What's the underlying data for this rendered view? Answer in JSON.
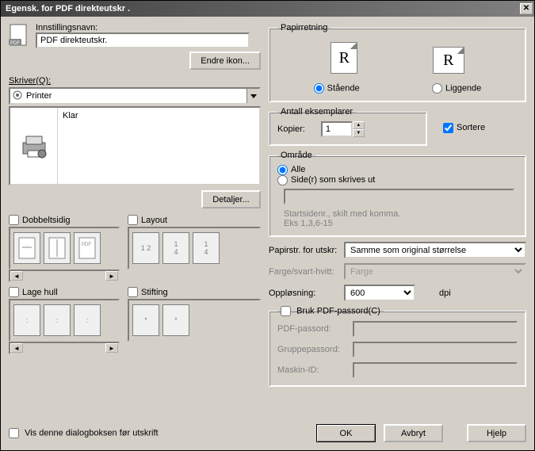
{
  "window": {
    "title": "Egensk. for PDF direkteutskr ."
  },
  "settings": {
    "name_label": "Innstillingsnavn:",
    "name_value": "PDF direkteutskr.",
    "change_icon_btn": "Endre ikon..."
  },
  "printer": {
    "label": "Skriver(Q):",
    "selected": "Printer",
    "status": "Klar",
    "details_btn": "Detaljer..."
  },
  "duplex": {
    "label": "Dobbeltsidig"
  },
  "layout": {
    "label": "Layout"
  },
  "punch": {
    "label": "Lage hull"
  },
  "staple": {
    "label": "Stifting"
  },
  "show_dialog": {
    "label": "Vis denne dialogboksen før utskrift"
  },
  "orientation": {
    "legend": "Papirretning",
    "portrait": "Stående",
    "landscape": "Liggende",
    "glyph": "R"
  },
  "copies": {
    "legend": "Antall eksemplarer",
    "label": "Kopier:",
    "value": "1",
    "collate": "Sortere"
  },
  "range": {
    "legend": "Område",
    "all": "Alle",
    "pages": "Side(r) som skrives ut",
    "hint1": "Startsidenr., skilt med komma.",
    "hint2": "Eks 1,3,6-15"
  },
  "paper": {
    "size_label": "Papirstr. for utskr:",
    "size_value": "Samme som original størrelse",
    "color_label": "Farge/svart-hvitt:",
    "color_value": "Farge",
    "res_label": "Oppløsning:",
    "res_value": "600",
    "res_unit": "dpi"
  },
  "pdf": {
    "legend": "Bruk PDF-passord(C)",
    "pwd_label": "PDF-passord:",
    "group_label": "Gruppepassord:",
    "machine_label": "Maskin-ID:"
  },
  "buttons": {
    "ok": "OK",
    "cancel": "Avbryt",
    "help": "Hjelp"
  }
}
